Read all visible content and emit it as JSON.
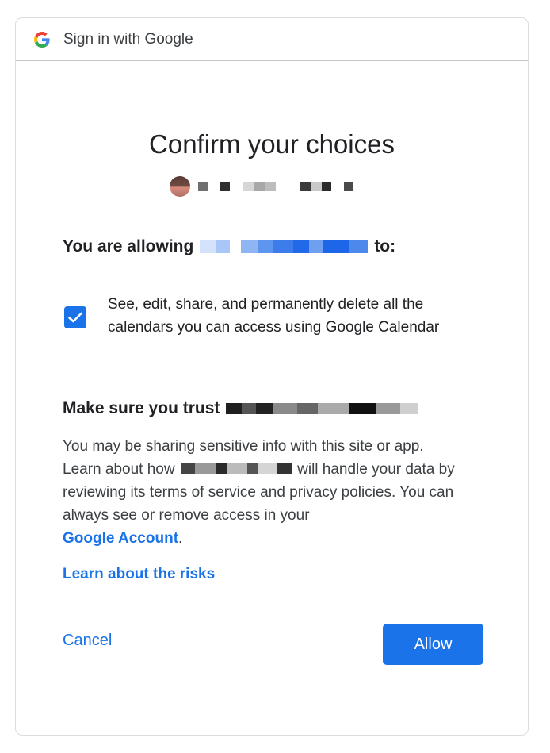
{
  "header": {
    "title": "Sign in with Google",
    "logo_icon": "google-g-icon"
  },
  "consent": {
    "title": "Confirm your choices",
    "account_avatar_icon": "account-avatar-icon",
    "allowing_prefix": "You are allowing",
    "allowing_suffix": "to:",
    "permission": {
      "checked": true,
      "text": "See, edit, share, and permanently delete all the calendars you can access using Google Calendar"
    },
    "trust_title_prefix": "Make sure you trust",
    "body_line1": "You may be sharing sensitive info with this site or app.",
    "body_learn_prefix": "Learn about how",
    "body_learn_suffix": "will handle your data by reviewing its terms of service and privacy policies. You can always see or remove access in your",
    "account_link": "Google Account",
    "period": ".",
    "risks_link": "Learn about the risks"
  },
  "actions": {
    "cancel_label": "Cancel",
    "allow_label": "Allow"
  },
  "colors": {
    "accent": "#1a73e8",
    "text": "#202124",
    "border": "#dadce0"
  }
}
